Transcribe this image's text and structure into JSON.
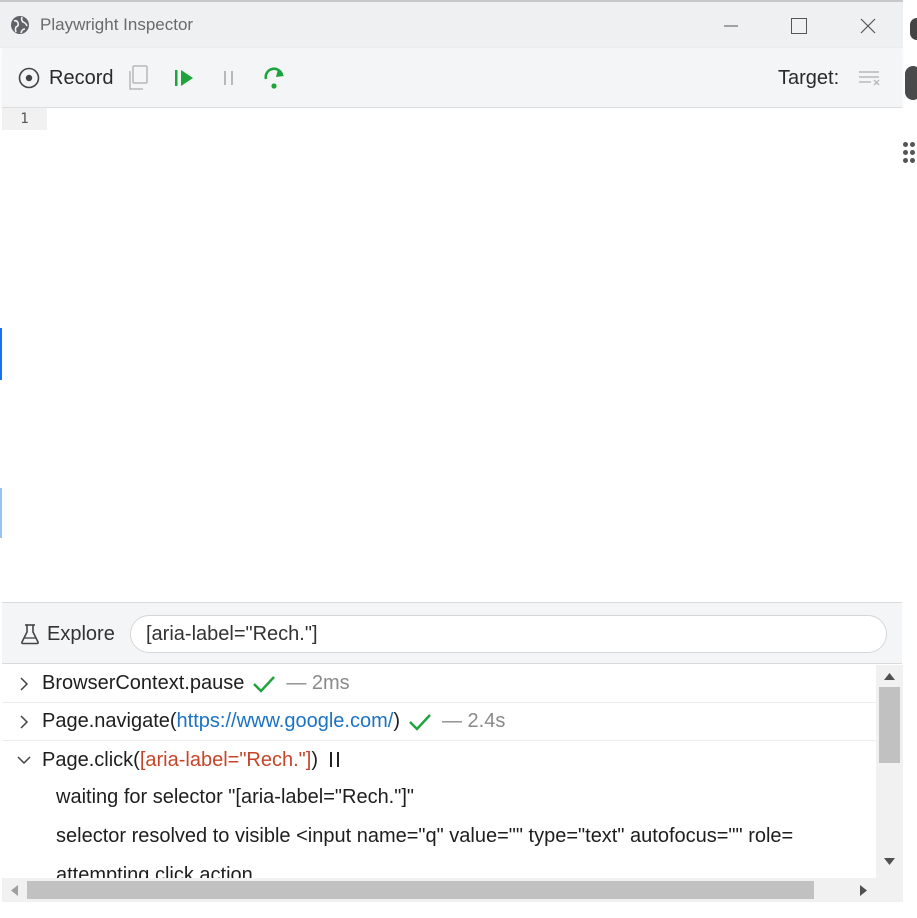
{
  "window": {
    "title": "Playwright Inspector"
  },
  "toolbar": {
    "record_label": "Record",
    "target_label": "Target:",
    "icons": [
      "record-icon",
      "copy-icon",
      "resume-icon",
      "pause-icon",
      "step-over-icon",
      "clear-list-icon"
    ],
    "colors": {
      "resume": "#1fa33b",
      "step": "#1fa33b",
      "disabled": "#b8b8b8"
    }
  },
  "editor": {
    "line_numbers": [
      "1"
    ],
    "lines": [
      ""
    ]
  },
  "explore": {
    "label": "Explore",
    "selector_value": "[aria-label=\"Rech.\"]"
  },
  "log": {
    "entries": [
      {
        "name": "BrowserContext.pause",
        "param": "",
        "status": "success",
        "duration": "— 2ms",
        "expanded": false
      },
      {
        "name": "Page.navigate(",
        "param": "https://www.google.com/",
        "suffix": ")",
        "status": "success",
        "duration": "— 2.4s",
        "expanded": false
      },
      {
        "name": "Page.click(",
        "param": "[aria-label=\"Rech.\"]",
        "suffix": ")",
        "status": "paused",
        "duration": "",
        "expanded": true
      }
    ],
    "details": [
      "waiting for selector \"[aria-label=\"Rech.\"]\"",
      "selector resolved to visible <input name=\"q\" value=\"\" type=\"text\" autofocus=\"\" role=",
      "attempting click action"
    ]
  }
}
